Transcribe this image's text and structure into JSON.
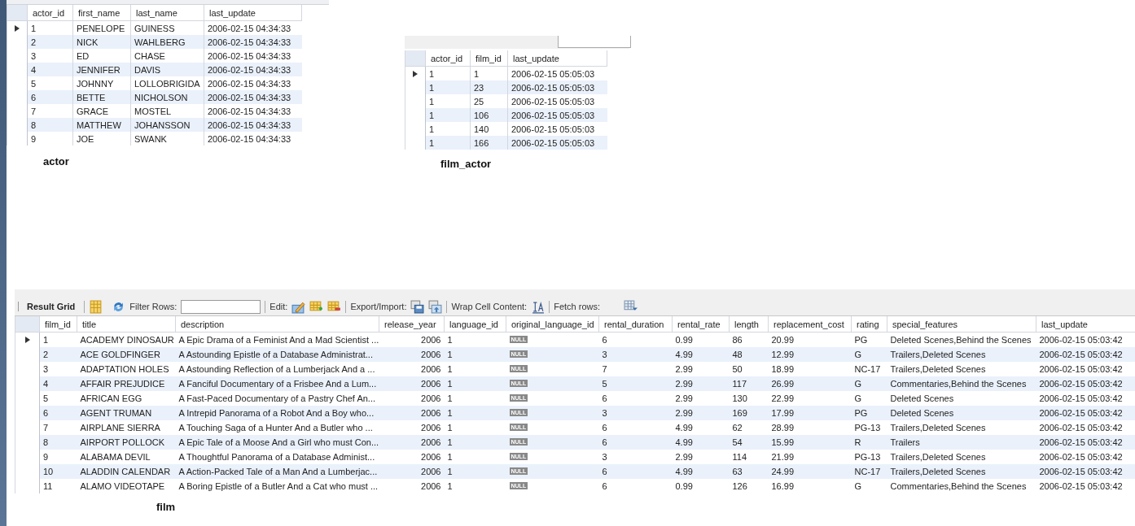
{
  "grids": [
    {
      "caption": "actor",
      "columns": [
        {
          "label": "actor_id",
          "kind": "text"
        },
        {
          "label": "first_name",
          "kind": "text"
        },
        {
          "label": "last_name",
          "kind": "text"
        },
        {
          "label": "last_update",
          "kind": "text"
        }
      ],
      "rows": [
        {
          "selected": true,
          "cells": [
            "1",
            "PENELOPE",
            "GUINESS",
            "2006-02-15 04:34:33"
          ]
        },
        {
          "selected": false,
          "cells": [
            "2",
            "NICK",
            "WAHLBERG",
            "2006-02-15 04:34:33"
          ]
        },
        {
          "selected": false,
          "cells": [
            "3",
            "ED",
            "CHASE",
            "2006-02-15 04:34:33"
          ]
        },
        {
          "selected": false,
          "cells": [
            "4",
            "JENNIFER",
            "DAVIS",
            "2006-02-15 04:34:33"
          ]
        },
        {
          "selected": false,
          "cells": [
            "5",
            "JOHNNY",
            "LOLLOBRIGIDA",
            "2006-02-15 04:34:33"
          ]
        },
        {
          "selected": false,
          "cells": [
            "6",
            "BETTE",
            "NICHOLSON",
            "2006-02-15 04:34:33"
          ]
        },
        {
          "selected": false,
          "cells": [
            "7",
            "GRACE",
            "MOSTEL",
            "2006-02-15 04:34:33"
          ]
        },
        {
          "selected": false,
          "cells": [
            "8",
            "MATTHEW",
            "JOHANSSON",
            "2006-02-15 04:34:33"
          ]
        },
        {
          "selected": false,
          "cells": [
            "9",
            "JOE",
            "SWANK",
            "2006-02-15 04:34:33"
          ]
        }
      ]
    },
    {
      "caption": "film_actor",
      "columns": [
        {
          "label": "actor_id",
          "kind": "text"
        },
        {
          "label": "film_id",
          "kind": "text"
        },
        {
          "label": "last_update",
          "kind": "text"
        }
      ],
      "rows": [
        {
          "selected": true,
          "cells": [
            "1",
            "1",
            "2006-02-15 05:05:03"
          ]
        },
        {
          "selected": false,
          "cells": [
            "1",
            "23",
            "2006-02-15 05:05:03"
          ]
        },
        {
          "selected": false,
          "cells": [
            "1",
            "25",
            "2006-02-15 05:05:03"
          ]
        },
        {
          "selected": false,
          "cells": [
            "1",
            "106",
            "2006-02-15 05:05:03"
          ]
        },
        {
          "selected": false,
          "cells": [
            "1",
            "140",
            "2006-02-15 05:05:03"
          ]
        },
        {
          "selected": false,
          "cells": [
            "1",
            "166",
            "2006-02-15 05:05:03"
          ]
        }
      ]
    },
    {
      "caption": "film",
      "toolbar": {
        "result_grid": "Result Grid",
        "filter_label": "Filter Rows:",
        "edit_label": "Edit:",
        "export_label": "Export/Import:",
        "wrap_label": "Wrap Cell Content:",
        "fetch_label": "Fetch rows:"
      },
      "columns": [
        {
          "label": "film_id",
          "kind": "text"
        },
        {
          "label": "title",
          "kind": "text"
        },
        {
          "label": "description",
          "kind": "text"
        },
        {
          "label": "release_year",
          "kind": "number"
        },
        {
          "label": "language_id",
          "kind": "text"
        },
        {
          "label": "original_language_id",
          "kind": "badge"
        },
        {
          "label": "rental_duration",
          "kind": "text"
        },
        {
          "label": "rental_rate",
          "kind": "text"
        },
        {
          "label": "length",
          "kind": "text"
        },
        {
          "label": "replacement_cost",
          "kind": "text"
        },
        {
          "label": "rating",
          "kind": "text"
        },
        {
          "label": "special_features",
          "kind": "text"
        },
        {
          "label": "last_update",
          "kind": "text"
        }
      ],
      "rows": [
        {
          "selected": true,
          "cells": [
            "1",
            "ACADEMY DINOSAUR",
            "A Epic Drama of a Feminist And a Mad Scientist ...",
            "2006",
            "1",
            "NULL",
            "6",
            "0.99",
            "86",
            "20.99",
            "PG",
            "Deleted Scenes,Behind the Scenes",
            "2006-02-15 05:03:42"
          ]
        },
        {
          "selected": false,
          "cells": [
            "2",
            "ACE GOLDFINGER",
            "A Astounding Epistle of a Database Administrat...",
            "2006",
            "1",
            "NULL",
            "3",
            "4.99",
            "48",
            "12.99",
            "G",
            "Trailers,Deleted Scenes",
            "2006-02-15 05:03:42"
          ]
        },
        {
          "selected": false,
          "cells": [
            "3",
            "ADAPTATION HOLES",
            "A Astounding Reflection of a Lumberjack And a ...",
            "2006",
            "1",
            "NULL",
            "7",
            "2.99",
            "50",
            "18.99",
            "NC-17",
            "Trailers,Deleted Scenes",
            "2006-02-15 05:03:42"
          ]
        },
        {
          "selected": false,
          "cells": [
            "4",
            "AFFAIR PREJUDICE",
            "A Fanciful Documentary of a Frisbee And a Lum...",
            "2006",
            "1",
            "NULL",
            "5",
            "2.99",
            "117",
            "26.99",
            "G",
            "Commentaries,Behind the Scenes",
            "2006-02-15 05:03:42"
          ]
        },
        {
          "selected": false,
          "cells": [
            "5",
            "AFRICAN EGG",
            "A Fast-Paced Documentary of a Pastry Chef An...",
            "2006",
            "1",
            "NULL",
            "6",
            "2.99",
            "130",
            "22.99",
            "G",
            "Deleted Scenes",
            "2006-02-15 05:03:42"
          ]
        },
        {
          "selected": false,
          "cells": [
            "6",
            "AGENT TRUMAN",
            "A Intrepid Panorama of a Robot And a Boy who...",
            "2006",
            "1",
            "NULL",
            "3",
            "2.99",
            "169",
            "17.99",
            "PG",
            "Deleted Scenes",
            "2006-02-15 05:03:42"
          ]
        },
        {
          "selected": false,
          "cells": [
            "7",
            "AIRPLANE SIERRA",
            "A Touching Saga of a Hunter And a Butler who ...",
            "2006",
            "1",
            "NULL",
            "6",
            "4.99",
            "62",
            "28.99",
            "PG-13",
            "Trailers,Deleted Scenes",
            "2006-02-15 05:03:42"
          ]
        },
        {
          "selected": false,
          "cells": [
            "8",
            "AIRPORT POLLOCK",
            "A Epic Tale of a Moose And a Girl who must Con...",
            "2006",
            "1",
            "NULL",
            "6",
            "4.99",
            "54",
            "15.99",
            "R",
            "Trailers",
            "2006-02-15 05:03:42"
          ]
        },
        {
          "selected": false,
          "cells": [
            "9",
            "ALABAMA DEVIL",
            "A Thoughtful Panorama of a Database Administ...",
            "2006",
            "1",
            "NULL",
            "3",
            "2.99",
            "114",
            "21.99",
            "PG-13",
            "Trailers,Deleted Scenes",
            "2006-02-15 05:03:42"
          ]
        },
        {
          "selected": false,
          "cells": [
            "10",
            "ALADDIN CALENDAR",
            "A Action-Packed Tale of a Man And a Lumberjac...",
            "2006",
            "1",
            "NULL",
            "6",
            "4.99",
            "63",
            "24.99",
            "NC-17",
            "Trailers,Deleted Scenes",
            "2006-02-15 05:03:42"
          ]
        },
        {
          "selected": false,
          "cells": [
            "11",
            "ALAMO VIDEOTAPE",
            "A Boring Epistle of a Butler And a Cat who must ...",
            "2006",
            "1",
            "NULL",
            "6",
            "0.99",
            "126",
            "16.99",
            "G",
            "Commentaries,Behind the Scenes",
            "2006-02-15 05:03:42"
          ]
        }
      ]
    }
  ]
}
